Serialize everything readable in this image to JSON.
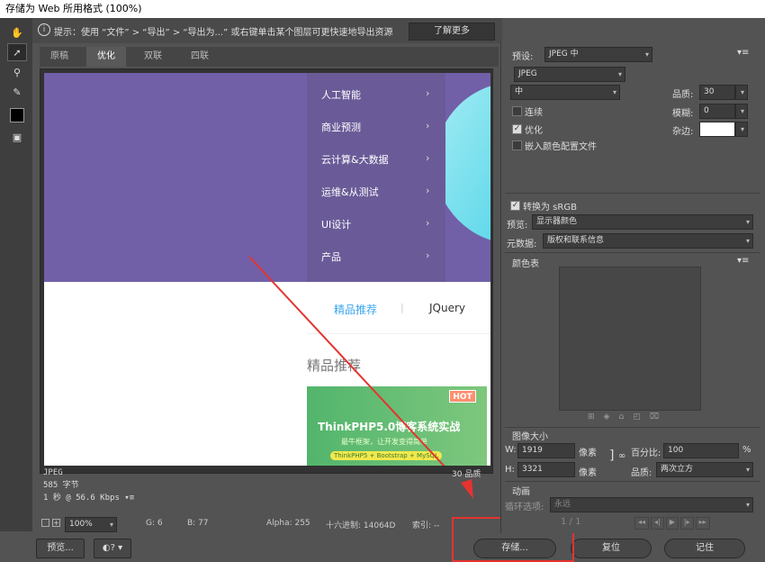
{
  "window": {
    "title": "存储为 Web 所用格式 (100%)"
  },
  "hint": {
    "text": "提示：使用 “文件” > “导出” > “导出为...” 或右键单击某个图层可更快速地导出资源",
    "learn_more": "了解更多"
  },
  "tabs": [
    "原稿",
    "优化",
    "双联",
    "四联"
  ],
  "preview": {
    "menu": [
      "人工智能",
      "商业预测",
      "云计算&大数据",
      "运维&从测试",
      "UI设计",
      "产品"
    ],
    "subnav": [
      "精品推荐",
      "JQuery"
    ],
    "section_title": "精品推荐",
    "promo": {
      "hot": "HOT",
      "title": "ThinkPHP5.0博客系统实战",
      "subtitle": "最牛框架，让开发变得简单",
      "badge": "ThinkPHP5 + Bootstrap + MySQL"
    }
  },
  "info": {
    "format": "JPEG",
    "size": "585 字节",
    "time": "1 秒 @ 56.6 Kbps",
    "quality": "30 品质"
  },
  "status": {
    "zoom": "100%",
    "g": "G: 6",
    "b": "B: 77",
    "alpha": "Alpha: 255",
    "hex": "十六进制: 14064D",
    "index": "索引: --"
  },
  "bottom": {
    "preview": "预览...",
    "save": "存储...",
    "reset": "复位",
    "remember": "记住"
  },
  "settings": {
    "preset_label": "预设:",
    "preset": "JPEG 中",
    "format": "JPEG",
    "quality_preset": "中",
    "quality_label": "品质:",
    "quality": "30",
    "progressive": "连续",
    "blur_label": "模糊:",
    "blur": "0",
    "optimized": "优化",
    "matte_label": "杂边:",
    "embed_profile": "嵌入颜色配置文件",
    "convert_srgb": "转换为 sRGB",
    "preview_label": "预览:",
    "preview_value": "显示器颜色",
    "metadata_label": "元数据:",
    "metadata_value": "版权和联系信息",
    "color_table_label": "颜色表",
    "image_size_label": "图像大小",
    "w_label": "W:",
    "w": "1919",
    "h_label": "H:",
    "h": "3321",
    "px": "像素",
    "percent_label": "百分比:",
    "percent": "100",
    "percent_unit": "%",
    "resample_label": "品质:",
    "resample": "两次立方",
    "animation_label": "动画",
    "loop_label": "循环选项:",
    "loop": "永远",
    "frame": "1 / 1"
  },
  "colors": {
    "accent_red": "#e5332f",
    "banner_purple": "#7160a8"
  }
}
